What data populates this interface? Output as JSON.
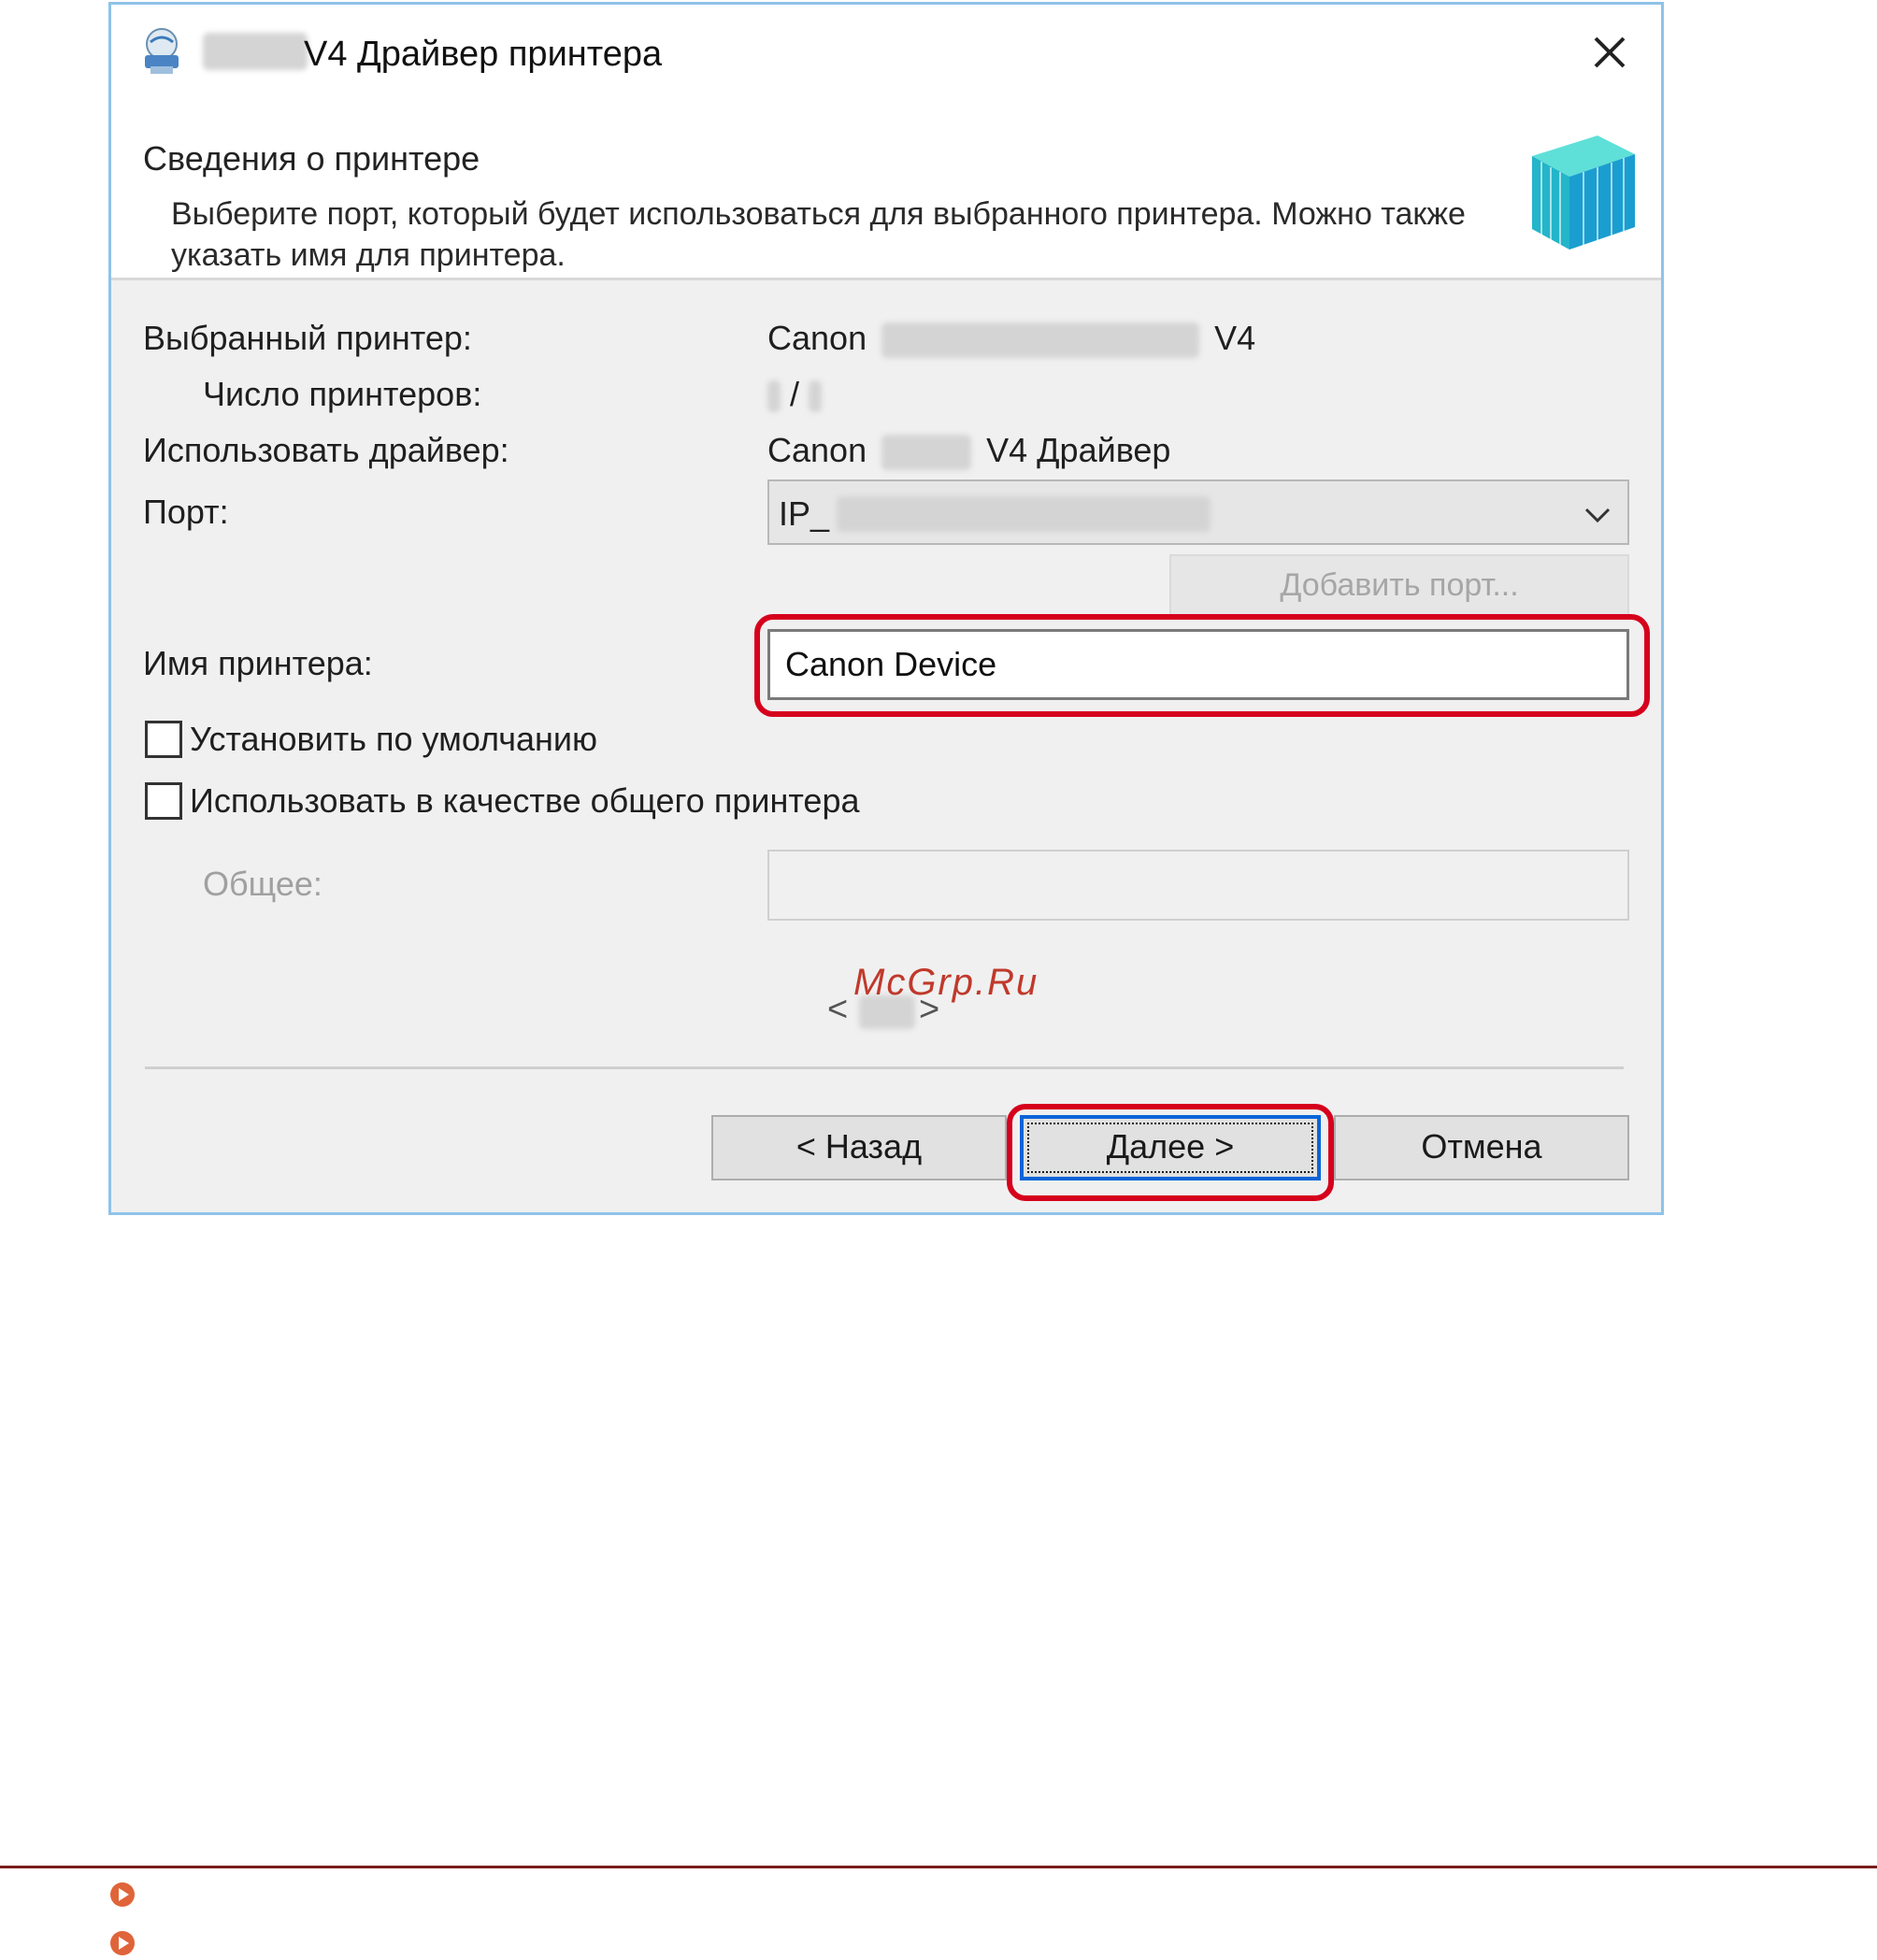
{
  "window": {
    "title": "V4 Драйвер принтера",
    "close_icon": "close-icon"
  },
  "header": {
    "title": "Сведения о принтере",
    "description": "Выберите порт, который будет использоваться для выбранного принтера. Можно также указать имя для принтера."
  },
  "fields": {
    "selected_printer_label": "Выбранный принтер:",
    "selected_printer_prefix": "Canon",
    "selected_printer_suffix": "V4",
    "printer_count_label": "Число принтеров:",
    "printer_count_value": "/",
    "driver_label": "Использовать драйвер:",
    "driver_prefix": "Canon",
    "driver_suffix": "V4 Драйвер",
    "port_label": "Порт:",
    "port_value": "IP_",
    "add_port_button": "Добавить порт...",
    "printer_name_label": "Имя принтера:",
    "printer_name_value": "Canon Device",
    "set_default_label": "Установить по умолчанию",
    "share_label": "Использовать в качестве общего принтера",
    "shared_name_label": "Общее:",
    "shared_name_value": ""
  },
  "pager": {
    "prev": "<",
    "next": ">"
  },
  "watermark": "McGrp.Ru",
  "buttons": {
    "back": "< Назад",
    "next": "Далее >",
    "cancel": "Отмена"
  },
  "colors": {
    "highlight": "#d6001c",
    "window_border": "#8fc3e8",
    "focus": "#0a64d8",
    "bullet": "#e0643a"
  }
}
